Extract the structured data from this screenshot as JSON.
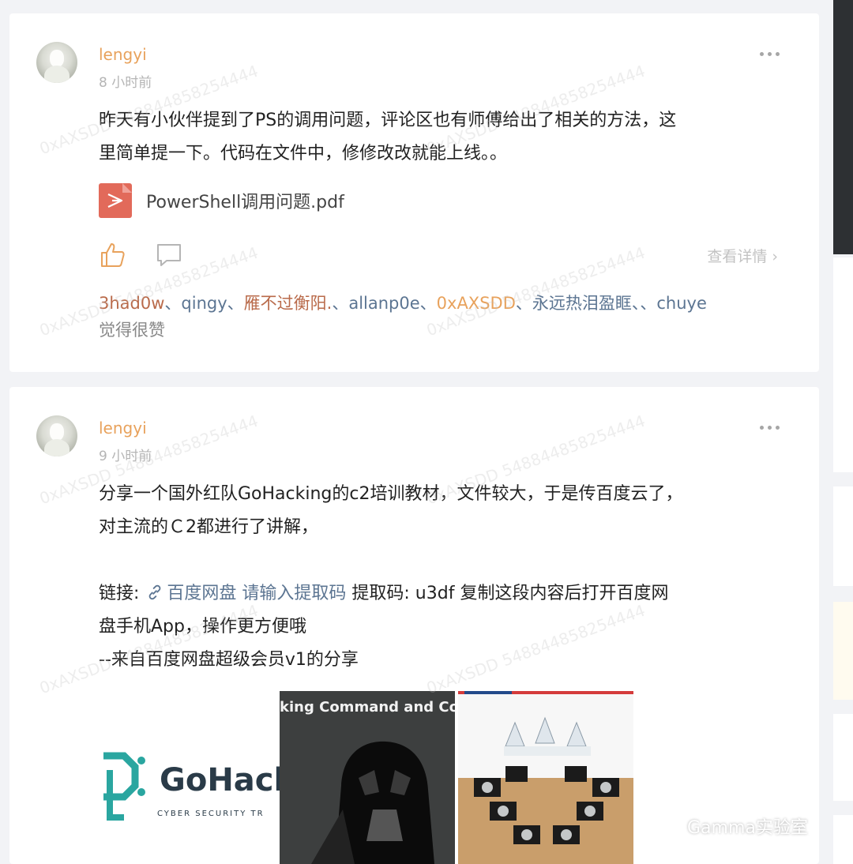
{
  "posts": [
    {
      "username": "lengyi",
      "time": "8 小时前",
      "text_lines": [
        "昨天有小伙伴提到了PS的调用问题，评论区也有师傅给出了相关的方法，这",
        "里简单提一下。代码在文件中，修修改改就能上线。。"
      ],
      "attachment": "PowerShell调用问题.pdf",
      "detail_label": "查看详情",
      "likers": [
        "3had0w",
        "qingy",
        "雁不过衡阳.",
        "allanp0e",
        "0xAXSDD",
        "永远热泪盈眶、",
        "chuye"
      ],
      "liker_suffix": "觉得很赞"
    },
    {
      "username": "lengyi",
      "time": "9 小时前",
      "text_lines": [
        "分享一个国外红队GoHacking的c2培训教材，文件较大，于是传百度云了，",
        "对主流的Ｃ2都进行了讲解，"
      ],
      "link_prefix": "链接: ",
      "link_text": "百度网盘 请输入提取码",
      "link_suffix_line1": " 提取码: u3df 复制这段内容后打开百度网",
      "link_line2": "盘手机App，操作更方便哦",
      "link_line3": "--来自百度网盘超级会员v1的分享",
      "images": [
        {
          "main": "GoHack",
          "sub": "CYBER SECURITY TR"
        },
        {
          "caption": "king Command and Co"
        },
        {
          "caption": ""
        }
      ]
    }
  ],
  "watermark": "0xAXSDD 548844858254444",
  "footer_brand": "Gamma实验室",
  "colors": {
    "accent": "#e8a25c",
    "link": "#5c7592",
    "pdf": "#e26a5a"
  }
}
